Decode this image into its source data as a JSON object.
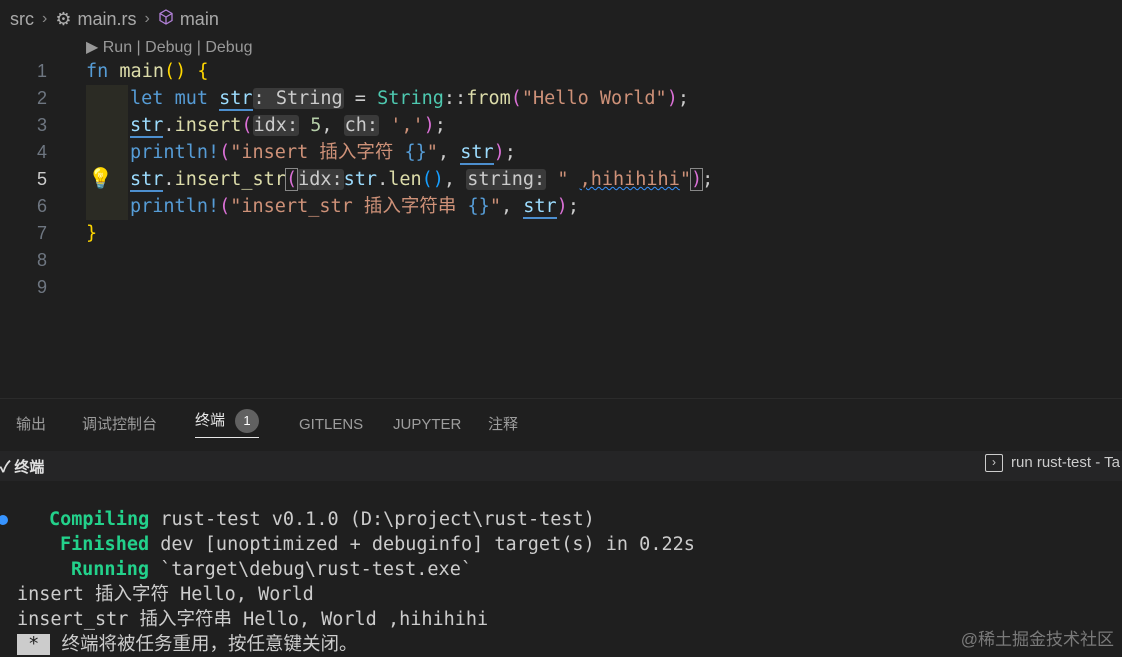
{
  "breadcrumb": {
    "folder": "src",
    "file": "main.rs",
    "symbol": "main",
    "file_icon": "rust-icon",
    "symbol_icon": "cube-icon"
  },
  "codelens": "▶ Run | Debug | Debug",
  "editor": {
    "active_line": 5,
    "line_numbers": [
      "1",
      "2",
      "3",
      "4",
      "5",
      "6",
      "7",
      "8",
      "9"
    ]
  },
  "panel": {
    "tabs": [
      "输出",
      "调试控制台",
      "终端",
      "GITLENS",
      "JUPYTER",
      "注释"
    ],
    "active_tab": "终端",
    "badge_count": "1",
    "terminal_title": "终端",
    "task_label": "run rust-test - Ta",
    "terminal": {
      "line1_label": "Compiling",
      "line1_text": " rust-test v0.1.0 (D:\\project\\rust-test)",
      "line2_label": "Finished",
      "line2_text": " dev [unoptimized + debuginfo] target(s) in 0.22s",
      "line3_label": "Running",
      "line3_text": " `target\\debug\\rust-test.exe`",
      "line4": "insert 插入字符 Hello, World",
      "line5": "insert_str 插入字符串 Hello, World ,hihihihi",
      "line6_star": " * ",
      "line6_text": " 终端将被任务重用，按任意键关闭。"
    }
  },
  "watermark": "@稀土掘金技术社区",
  "colors": {
    "background": "#1f1f1f",
    "keyword": "#569cd6",
    "string": "#ce9178",
    "type": "#4ec9b0",
    "terminal_green": "#23d18b"
  }
}
